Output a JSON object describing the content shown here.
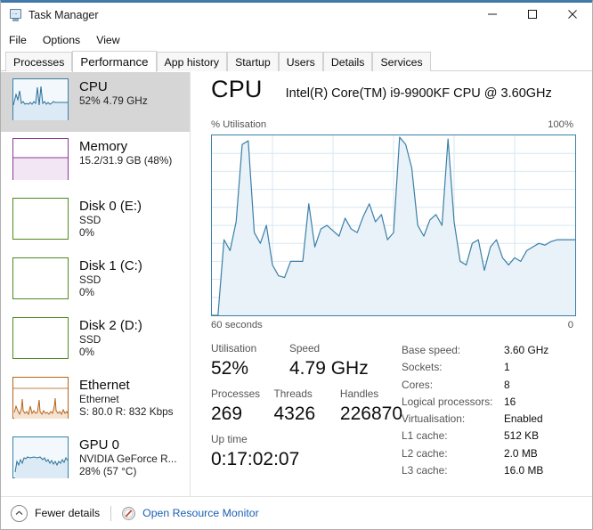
{
  "window": {
    "title": "Task Manager",
    "icon": "task-manager-icon",
    "controls": {
      "minimize": "minimize-icon",
      "maximize": "maximize-icon",
      "close": "close-icon"
    }
  },
  "menubar": {
    "items": [
      "File",
      "Options",
      "View"
    ]
  },
  "tabs": {
    "items": [
      "Processes",
      "Performance",
      "App history",
      "Startup",
      "Users",
      "Details",
      "Services"
    ],
    "active": "Performance"
  },
  "sidebar": {
    "items": [
      {
        "name": "CPU",
        "sub": "52% 4.79 GHz",
        "sub2": "",
        "selected": true,
        "color": "#3b7fa8",
        "graph": "cpu"
      },
      {
        "name": "Memory",
        "sub": "15.2/31.9 GB (48%)",
        "sub2": "",
        "selected": false,
        "color": "#8b3a94",
        "graph": "memory"
      },
      {
        "name": "Disk 0 (E:)",
        "sub": "SSD",
        "sub2": "0%",
        "selected": false,
        "color": "#4e8a1f",
        "graph": "flat"
      },
      {
        "name": "Disk 1 (C:)",
        "sub": "SSD",
        "sub2": "0%",
        "selected": false,
        "color": "#4e8a1f",
        "graph": "flat"
      },
      {
        "name": "Disk 2 (D:)",
        "sub": "SSD",
        "sub2": "0%",
        "selected": false,
        "color": "#4e8a1f",
        "graph": "flat"
      },
      {
        "name": "Ethernet",
        "sub": "Ethernet",
        "sub2": "S: 80.0 R: 832 Kbps",
        "selected": false,
        "color": "#b5651d",
        "graph": "ethernet"
      },
      {
        "name": "GPU 0",
        "sub": "NVIDIA GeForce R...",
        "sub2": "28%  (57 °C)",
        "selected": false,
        "color": "#3b7fa8",
        "graph": "gpu"
      }
    ]
  },
  "main": {
    "title": "CPU",
    "subtitle": "Intel(R) Core(TM) i9-9900KF CPU @ 3.60GHz",
    "y_axis_label": "% Utilisation",
    "y_axis_max": "100%",
    "x_axis_left": "60 seconds",
    "x_axis_right": "0"
  },
  "stats": {
    "row1": [
      {
        "label": "Utilisation",
        "value": "52%"
      },
      {
        "label": "Speed",
        "value": "4.79 GHz"
      }
    ],
    "row2": [
      {
        "label": "Processes",
        "value": "269"
      },
      {
        "label": "Threads",
        "value": "4326"
      },
      {
        "label": "Handles",
        "value": "226870"
      }
    ],
    "row3": [
      {
        "label": "Up time",
        "value": "0:17:02:07"
      }
    ],
    "details": [
      {
        "key": "Base speed:",
        "value": "3.60 GHz"
      },
      {
        "key": "Sockets:",
        "value": "1"
      },
      {
        "key": "Cores:",
        "value": "8"
      },
      {
        "key": "Logical processors:",
        "value": "16"
      },
      {
        "key": "Virtualisation:",
        "value": "Enabled"
      },
      {
        "key": "L1 cache:",
        "value": "512 KB"
      },
      {
        "key": "L2 cache:",
        "value": "2.0 MB"
      },
      {
        "key": "L3 cache:",
        "value": "16.0 MB"
      }
    ]
  },
  "footer": {
    "fewer_details": "Fewer details",
    "open_resource_monitor": "Open Resource Monitor"
  },
  "chart_data": {
    "type": "area",
    "title": "CPU Utilisation over time",
    "xlabel": "60 seconds",
    "ylabel": "% Utilisation",
    "ylim": [
      0,
      100
    ],
    "xlim": [
      60,
      0
    ],
    "grid": true,
    "line_color": "#3b7fa8",
    "fill_color": "#e8f2f8",
    "legend": "none",
    "x": [
      60,
      59,
      58,
      57,
      56,
      55,
      54,
      53,
      52,
      51,
      50,
      49,
      48,
      47,
      46,
      45,
      44,
      43,
      42,
      41,
      40,
      39,
      38,
      37,
      36,
      35,
      34,
      33,
      32,
      31,
      30,
      29,
      28,
      27,
      26,
      25,
      24,
      23,
      22,
      21,
      20,
      19,
      18,
      17,
      16,
      15,
      14,
      13,
      12,
      11,
      10,
      9,
      8,
      7,
      6,
      5,
      4,
      3,
      2,
      1,
      0
    ],
    "values": [
      0,
      0,
      42,
      36,
      52,
      95,
      97,
      46,
      40,
      50,
      28,
      22,
      21,
      30,
      30,
      30,
      62,
      38,
      48,
      50,
      47,
      44,
      54,
      48,
      46,
      55,
      62,
      52,
      56,
      42,
      46,
      99,
      95,
      82,
      50,
      44,
      53,
      56,
      50,
      98,
      52,
      30,
      28,
      40,
      42,
      25,
      38,
      42,
      32,
      28,
      32,
      30,
      36,
      38,
      40,
      39,
      41,
      42,
      42,
      42,
      42
    ]
  }
}
